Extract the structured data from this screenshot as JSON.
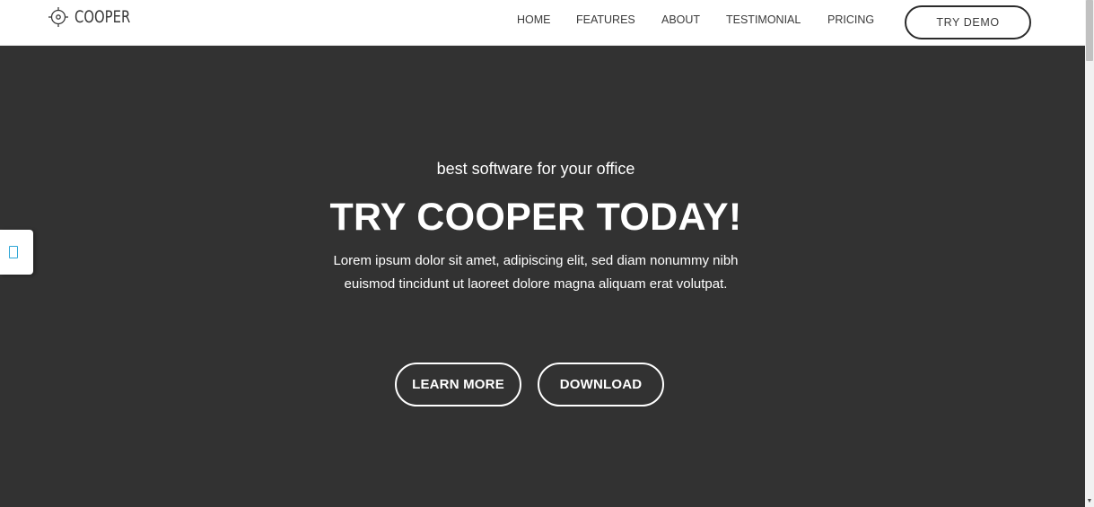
{
  "header": {
    "logo_text": "COOPER",
    "logo_icon": "crosshair-target-icon",
    "nav": [
      {
        "label": "HOME"
      },
      {
        "label": "FEATURES"
      },
      {
        "label": "ABOUT"
      },
      {
        "label": "TESTIMONIAL"
      },
      {
        "label": "PRICING"
      }
    ],
    "cta_label": "TRY DEMO"
  },
  "hero": {
    "subtitle": "best software for your office",
    "headline": "TRY COOPER TODAY!",
    "description": "Lorem ipsum dolor sit amet, adipiscing elit, sed diam nonummy nibh euismod tincidunt ut laoreet dolore magna aliquam erat volutpat.",
    "buttons": {
      "learn_more": "LEARN MORE",
      "download": "DOWNLOAD"
    }
  },
  "side_widget": {
    "icon": "tablet-icon"
  },
  "colors": {
    "hero_bg": "#323232",
    "header_bg": "#ffffff",
    "accent": "#2fa6d6",
    "text_light": "#ffffff",
    "text_dark": "#3a3a3a"
  }
}
